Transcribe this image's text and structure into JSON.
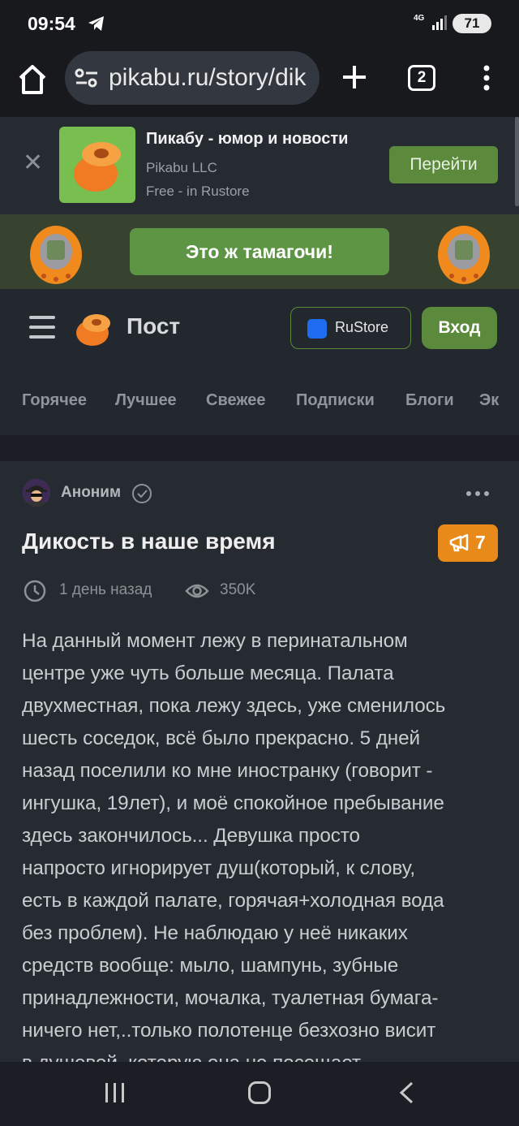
{
  "status_bar": {
    "time": "09:54",
    "network": "4G",
    "battery": "71"
  },
  "browser": {
    "url": "pikabu.ru/story/dik",
    "tab_count": "2"
  },
  "app_banner": {
    "title": "Пикабу - юмор и новости",
    "developer": "Pikabu LLC",
    "store": "Free - in Rustore",
    "button": "Перейти"
  },
  "promo": {
    "button": "Это ж тамагочи!"
  },
  "header": {
    "title": "Пост",
    "rustore_label": "RuStore",
    "login_label": "Вход"
  },
  "nav_tabs": [
    "Горячее",
    "Лучшее",
    "Свежее",
    "Подписки",
    "Блоги",
    "Эк"
  ],
  "post": {
    "author": "Аноним",
    "title": "Дикость в наше время",
    "rating": "7",
    "time": "1 день назад",
    "views": "350K",
    "body_lines": [
      "На данный момент лежу в перинатальном",
      "центре уже чуть больше месяца. Палата",
      "двухместная, пока лежу здесь, уже сменилось",
      "шесть соседок, всё было прекрасно. 5 дней",
      "назад поселили ко мне иностранку (говорит -",
      "ингушка, 19лет), и моё спокойное пребывание",
      "здесь закончилось... Девушка просто",
      "напросто игнорирует душ(который, к слову,",
      "есть в каждой палате, горячая+холодная вода",
      "без проблем). Не наблюдаю у неё никаких",
      "средств вообще: мыло, шампунь, зубные",
      "принадлежности, мочалка, туалетная бумага-",
      "ничего нет,..только полотенце безхозно висит",
      "в душевой, которую она не посещает."
    ]
  },
  "colors": {
    "accent_green": "#5b8a3c",
    "rating_orange": "#e78a1a",
    "background": "#1b1f25"
  }
}
